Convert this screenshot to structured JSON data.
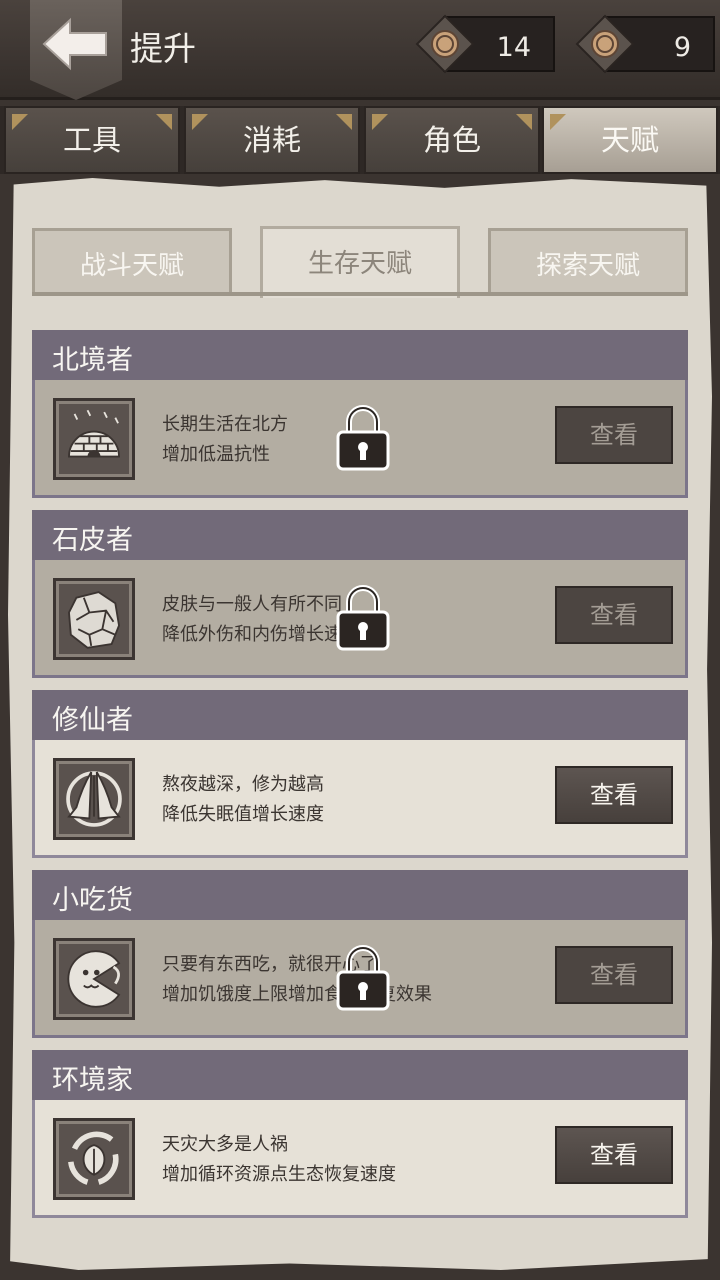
{
  "header": {
    "title": "提升"
  },
  "currency": [
    {
      "icon": "coin-icon",
      "value": "14"
    },
    {
      "icon": "coin-icon",
      "value": "9"
    }
  ],
  "tabs": [
    {
      "label": "工具",
      "active": false
    },
    {
      "label": "消耗",
      "active": false
    },
    {
      "label": "角色",
      "active": false
    },
    {
      "label": "天赋",
      "active": true
    }
  ],
  "subtabs": [
    {
      "label": "战斗天赋",
      "active": false
    },
    {
      "label": "生存天赋",
      "active": true
    },
    {
      "label": "探索天赋",
      "active": false
    }
  ],
  "talents": [
    {
      "name": "北境者",
      "desc1": "长期生活在北方",
      "desc2": "增加低温抗性",
      "button": "查看",
      "locked": true,
      "icon": "igloo-icon"
    },
    {
      "name": "石皮者",
      "desc1": "皮肤与一般人有所不同",
      "desc2": "降低外伤和内伤增长速度",
      "button": "查看",
      "locked": true,
      "icon": "stone-icon"
    },
    {
      "name": "修仙者",
      "desc1": "熬夜越深，修为越高",
      "desc2": "降低失眠值增长速度",
      "button": "查看",
      "locked": false,
      "icon": "praying-hands-icon"
    },
    {
      "name": "小吃货",
      "desc1": "只要有东西吃，就很开心了",
      "desc2": "增加饥饿度上限增加食物恢复效果",
      "button": "查看",
      "locked": true,
      "icon": "pacman-icon"
    },
    {
      "name": "环境家",
      "desc1": "天灾大多是人祸",
      "desc2": "增加循环资源点生态恢复速度",
      "button": "查看",
      "locked": false,
      "icon": "recycle-leaf-icon"
    }
  ],
  "colors": {
    "card_header": "#726a79",
    "paper": "#dcd7cd",
    "button": "#4f4844"
  }
}
